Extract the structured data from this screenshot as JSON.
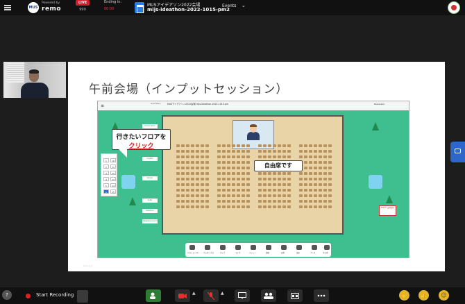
{
  "topbar": {
    "logo_text": "MUS",
    "powered_by": "Powered by",
    "brand": "remo",
    "live_label": "LIVE",
    "live_count": "999",
    "ending_label": "Ending in:",
    "ending_time": "00:00",
    "event_title": "MUSアイデアソン2022会場",
    "event_name": "mijs-ideathon-2022-1015-pm2",
    "events_label": "Events",
    "events_chevron": "⌄"
  },
  "slide": {
    "title": "午前会場（インプットセッション）",
    "callout_left_line1": "行きたいフロアを",
    "callout_left_line2": "クリック",
    "callout_right": "自由席です",
    "app_menu": "≡",
    "app_top_left": "Summary",
    "app_top_title": "MUSアイデアソン2022会場 mijs-ideathon-2022-1015-pm",
    "app_top_right": "Moderator",
    "floor_numbers": [
      "1",
      "10",
      "2",
      "11",
      "3",
      "12",
      "4",
      "13",
      "5",
      "14",
      "6",
      "15"
    ],
    "sponsors": [
      "Goose Vision",
      "Inlighte",
      "Kansai",
      "KoRe",
      "Newtone",
      "Hajime",
      "NewsMedia",
      "Magazine Coordi"
    ],
    "red_right_text": "Notion 会場案内",
    "bottom_labels": [
      "ゲストユーザー",
      "プレゼンする",
      "カメラ",
      "マイク",
      "チャット",
      "連絡",
      "会場",
      "設定",
      "ブース",
      "その他"
    ],
    "footer_text": "◎ ◎ ◎ ◎"
  },
  "bottombar": {
    "help": "?",
    "record_label": "Start Recording",
    "caret": "▲"
  },
  "colors": {
    "live_red": "#d21f2b",
    "app_green": "#3fbf8f",
    "toolbar_green": "#2e7d32",
    "side_tab_blue": "#2f66c9",
    "callout_red": "#e0161b"
  }
}
